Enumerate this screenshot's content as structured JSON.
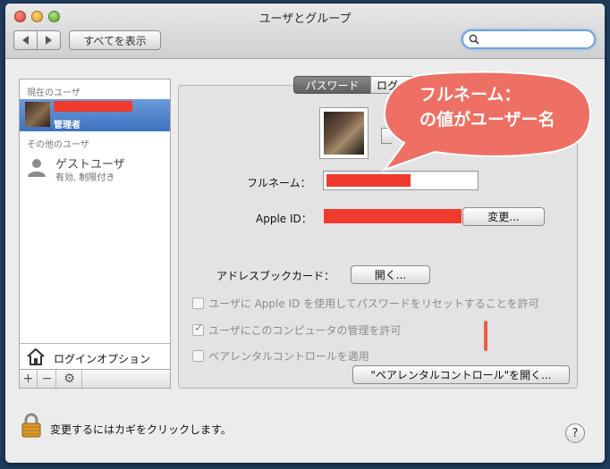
{
  "window": {
    "title": "ユーザとグループ"
  },
  "toolbar": {
    "show_all_label": "すべてを表示",
    "search": {
      "placeholder": "",
      "value": ""
    }
  },
  "sidebar": {
    "current_users_header": "現在のユーザ",
    "current_user": {
      "name": "",
      "role": "管理者"
    },
    "other_users_header": "その他のユーザ",
    "guest_user": {
      "name": "ゲストユーザ",
      "status": "有効, 制限付き"
    },
    "login_options_label": "ログインオプション",
    "add_symbol": "+",
    "remove_symbol": "−"
  },
  "tabs": [
    {
      "label": "パスワード",
      "selected": true
    },
    {
      "label": "ログイ",
      "selected": false
    }
  ],
  "form": {
    "full_name_label": "フルネーム：",
    "apple_id_label": "Apple ID：",
    "change_button_label": "変更...",
    "address_book_label": "アドレスブックカード：",
    "open_button_label": "開く...",
    "reset_password_checkbox": {
      "label": "ユーザに Apple ID を使用してパスワードをリセットすることを許可",
      "checked": false,
      "enabled": false
    },
    "admin_checkbox": {
      "label": "ユーザにこのコンピュータの管理を許可",
      "checked": true,
      "enabled": false
    },
    "parental_checkbox": {
      "label": "ペアレンタルコントロールを適用",
      "checked": false,
      "enabled": false
    },
    "open_parental_button_label": "\"ペアレンタルコントロール\"を開く..."
  },
  "callout": {
    "line1": "フルネーム：",
    "line2": "の値がユーザー名",
    "fill_color": "#ee6f63",
    "text_color": "#ffffff"
  },
  "footer": {
    "lock_text": "変更するにはカギをクリックします。",
    "help_symbol": "?"
  },
  "colors": {
    "redaction": "#f03a2d",
    "selection": "#4a7fc8",
    "desktop": "#1f3c5e"
  }
}
